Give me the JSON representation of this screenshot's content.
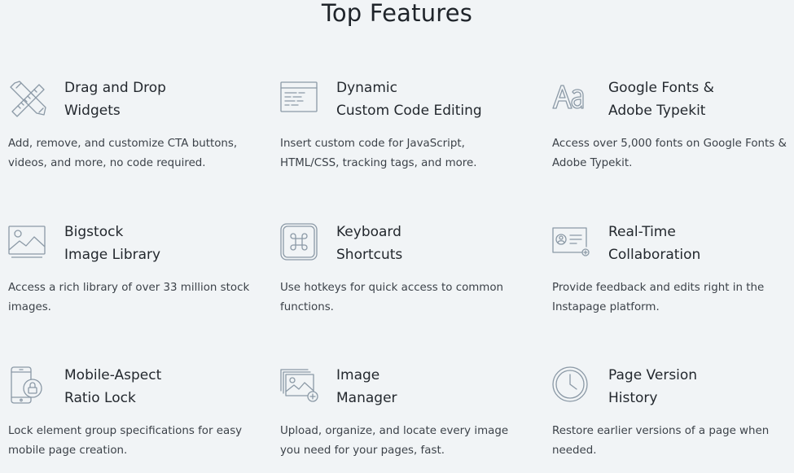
{
  "section": {
    "title": "Top Features"
  },
  "colors": {
    "background": "#f1f4f6",
    "icon": "#8b99a6",
    "title_text": "#23282e",
    "body_text": "#3c4249"
  },
  "features": [
    {
      "icon": "pencil-ruler-icon",
      "title": [
        "Drag and Drop",
        "Widgets"
      ],
      "desc": [
        "Add, remove, and customize CTA buttons,",
        "videos, and more, no code required."
      ]
    },
    {
      "icon": "code-window-icon",
      "title": [
        "Dynamic",
        "Custom Code Editing"
      ],
      "desc": [
        "Insert custom code for JavaScript,",
        "HTML/CSS, tracking tags, and more."
      ]
    },
    {
      "icon": "font-aa-icon",
      "title": [
        "Google Fonts &",
        "Adobe Typekit"
      ],
      "desc": [
        "Access over 5,000 fonts on Google Fonts &",
        "Adobe Typekit."
      ]
    },
    {
      "icon": "image-library-icon",
      "title": [
        "Bigstock",
        "Image Library"
      ],
      "desc": [
        "Access a rich library of over 33 million stock",
        "images."
      ]
    },
    {
      "icon": "command-key-icon",
      "title": [
        "Keyboard",
        "Shortcuts"
      ],
      "desc": [
        "Use hotkeys for quick access to common",
        "functions."
      ]
    },
    {
      "icon": "collaboration-card-icon",
      "title": [
        "Real-Time",
        "Collaboration"
      ],
      "desc": [
        "Provide feedback and edits right in the",
        "Instapage platform."
      ]
    },
    {
      "icon": "mobile-lock-icon",
      "title": [
        "Mobile-Aspect",
        "Ratio Lock"
      ],
      "desc": [
        "Lock element group specifications for easy",
        "mobile page creation."
      ]
    },
    {
      "icon": "image-stack-add-icon",
      "title": [
        "Image",
        "Manager"
      ],
      "desc": [
        "Upload, organize, and locate every image",
        "you need for your pages, fast."
      ]
    },
    {
      "icon": "clock-history-icon",
      "title": [
        "Page Version",
        "History"
      ],
      "desc": [
        "Restore earlier versions of a page when",
        "needed."
      ]
    }
  ]
}
